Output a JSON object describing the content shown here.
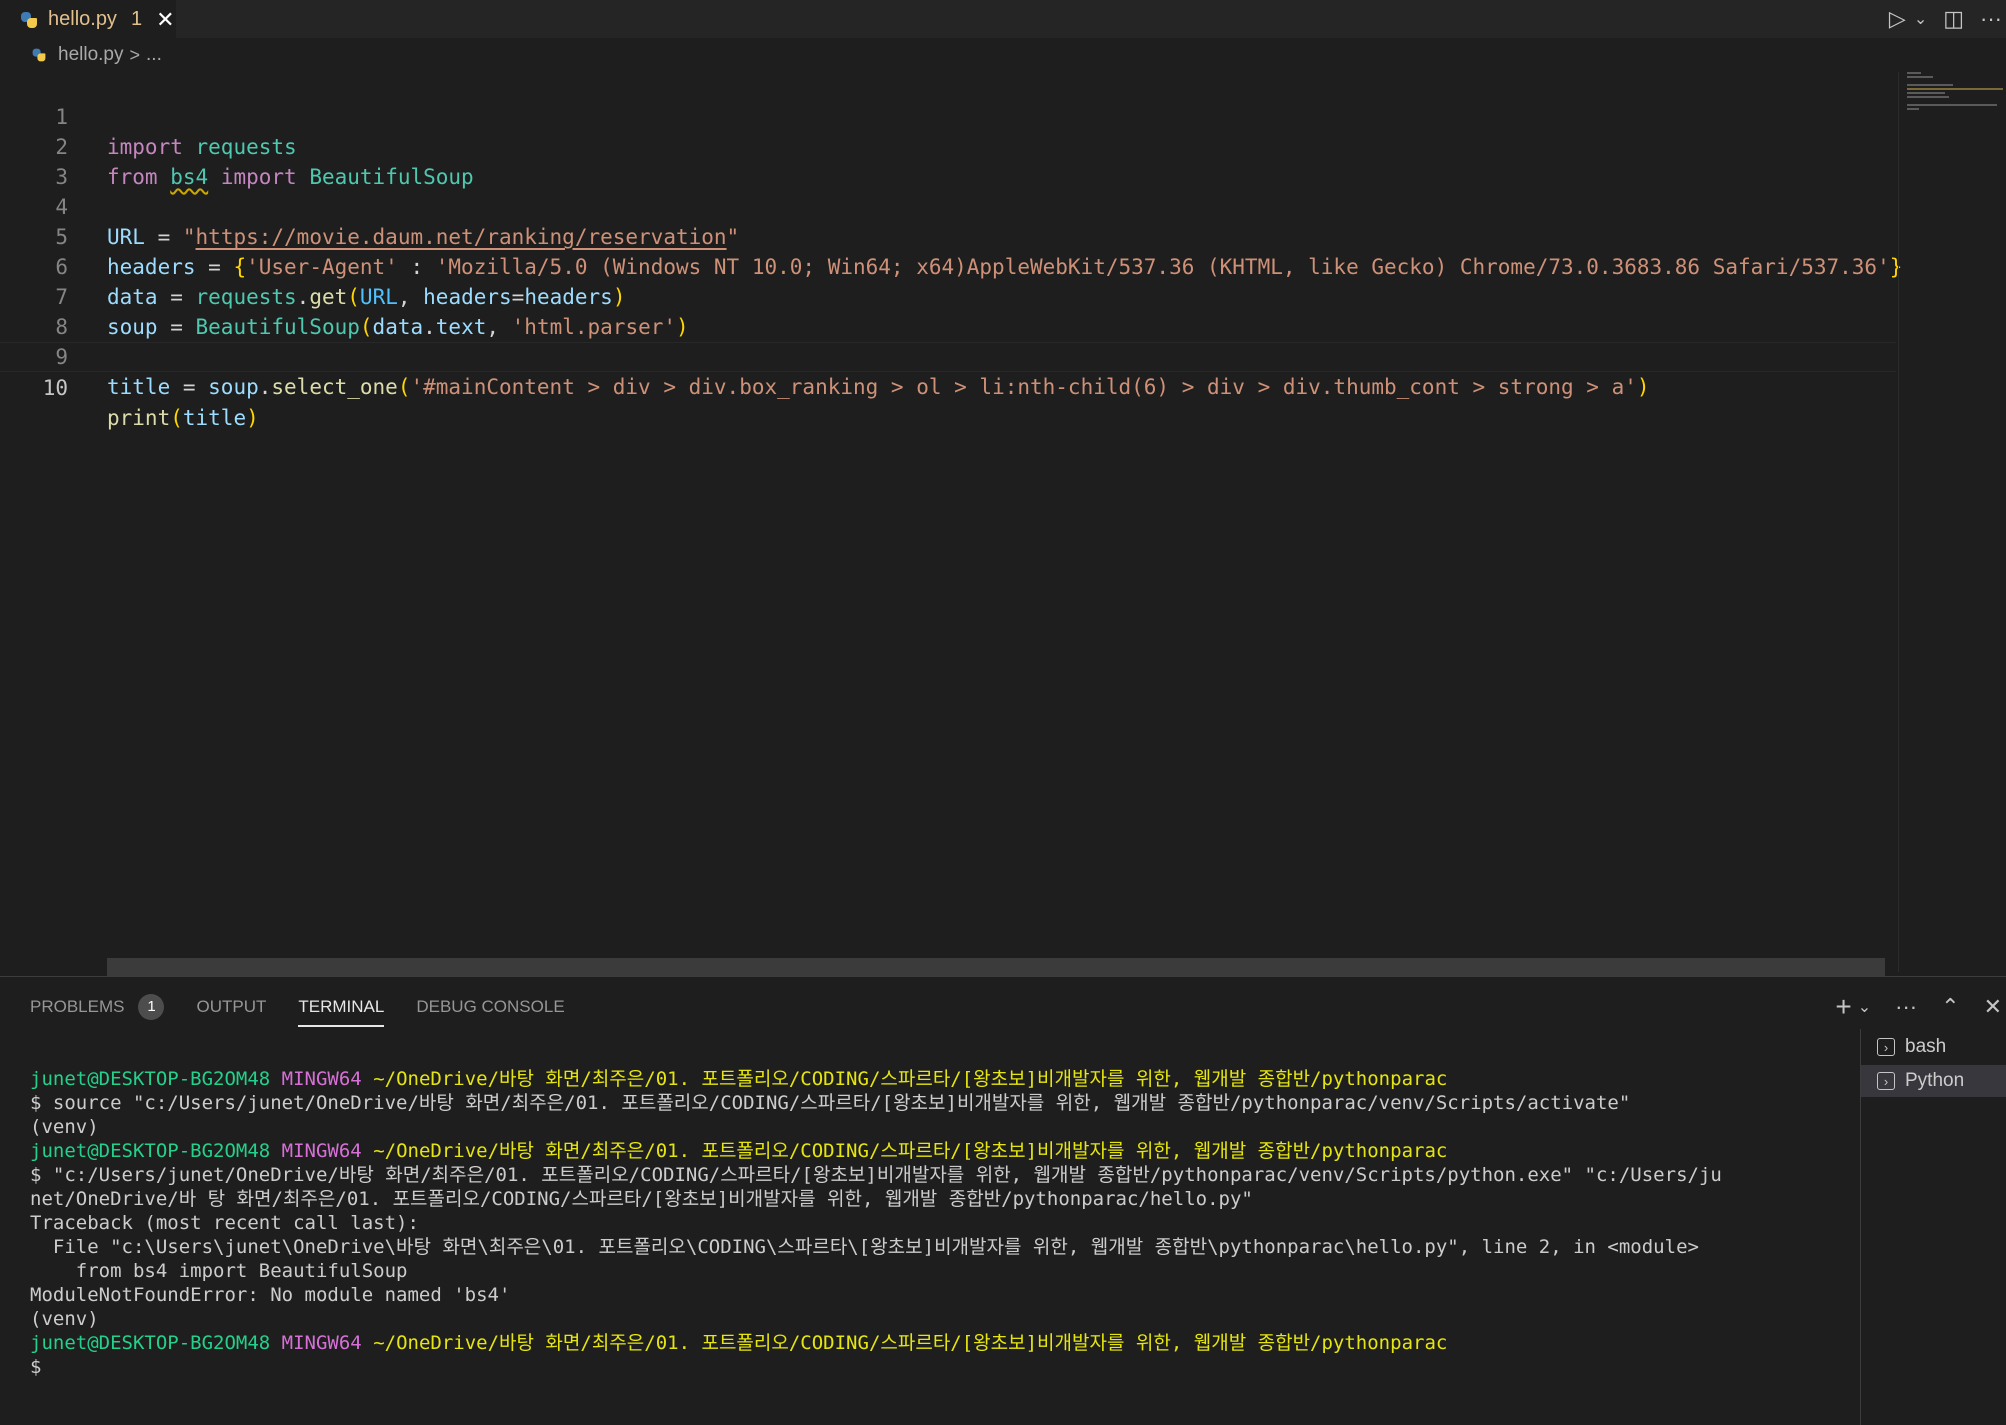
{
  "tab": {
    "filename": "hello.py",
    "problem_count": "1",
    "close_glyph": "✕"
  },
  "actions": {
    "run": "▷",
    "run_dropdown": "⌄",
    "split": "◫",
    "more": "···"
  },
  "breadcrumb": {
    "file": "hello.py",
    "separator": ">",
    "more": "..."
  },
  "editor": {
    "line_numbers": [
      "1",
      "2",
      "3",
      "4",
      "5",
      "6",
      "7",
      "8",
      "9",
      "10"
    ],
    "lines": [
      "import requests",
      "from bs4 import BeautifulSoup",
      "",
      "URL = \"https://movie.daum.net/ranking/reservation\"",
      "headers = {'User-Agent' : 'Mozilla/5.0 (Windows NT 10.0; Win64; x64)AppleWebKit/537.36 (KHTML, like Gecko) Chrome/73.0.3683.86 Safari/537.36'}",
      "data = requests.get(URL, headers=headers)",
      "soup = BeautifulSoup(data.text, 'html.parser')",
      "",
      "title = soup.select_one('#mainContent > div > div.box_ranking > ol > li:nth-child(6) > div > div.thumb_cont > strong > a')",
      "print(title)"
    ],
    "tokens": {
      "l1": [
        "import",
        " ",
        "requests"
      ],
      "l2": [
        "from",
        " ",
        "bs4",
        " ",
        "import",
        " ",
        "BeautifulSoup"
      ],
      "l4": [
        "URL",
        " = ",
        "\"",
        "https://movie.daum.net/ranking/reservation",
        "\""
      ],
      "l5": [
        "headers",
        " = ",
        "{",
        "'User-Agent'",
        " : ",
        "'Mozilla/5.0 (Windows NT 10.0; Win64; x64)AppleWebKit/537.36 (KHTML, like Gecko) Chrome/73.0.3683.86 Safari/537.36'",
        "}"
      ],
      "l6": [
        "data",
        " = ",
        "requests",
        ".",
        "get",
        "(",
        "URL",
        ", ",
        "headers",
        "=",
        "headers",
        ")"
      ],
      "l7": [
        "soup",
        " = ",
        "BeautifulSoup",
        "(",
        "data",
        ".",
        "text",
        ", ",
        "'html.parser'",
        ")"
      ],
      "l9": [
        "title",
        " = ",
        "soup",
        ".",
        "select_one",
        "(",
        "'#mainContent > div > div.box_ranking > ol > li:nth-child(6) > div > div.thumb_cont > strong > a'",
        ")"
      ],
      "l10": [
        "print",
        "(",
        "title",
        ")"
      ]
    }
  },
  "panel": {
    "tabs": [
      "PROBLEMS",
      "OUTPUT",
      "TERMINAL",
      "DEBUG CONSOLE"
    ],
    "problems_badge": "1",
    "actions": {
      "new_terminal": "+",
      "dropdown": "⌄",
      "more": "···",
      "maximize": "⌃",
      "close": "✕"
    },
    "terminal_sessions": [
      "bash",
      "Python"
    ]
  },
  "terminal": {
    "prompt_user": "junet@DESKTOP-BG2OM48",
    "prompt_system": "MINGW64",
    "prompt_path": "~/OneDrive/바탕 화면/최주은/01. 포트폴리오/CODING/스파르타/[왕초보]비개발자를 위한, 웹개발 종합반/pythonparac",
    "lines": [
      "$ source \"c:/Users/junet/OneDrive/바탕 화면/최주은/01. 포트폴리오/CODING/스파르타/[왕초보]비개발자를 위한, 웹개발 종합반/pythonparac/venv/Scripts/activate\"",
      "(venv)",
      "$ \"c:/Users/junet/OneDrive/바탕 화면/최주은/01. 포트폴리오/CODING/스파르타/[왕초보]비개발자를 위한, 웹개발 종합반/pythonparac/venv/Scripts/python.exe\" \"c:/Users/ju",
      "net/OneDrive/바 탕 화면/최주은/01. 포트폴리오/CODING/스파르타/[왕초보]비개발자를 위한, 웹개발 종합반/pythonparac/hello.py\"",
      "Traceback (most recent call last):",
      "  File \"c:\\Users\\junet\\OneDrive\\바탕 화면\\최주은\\01. 포트폴리오\\CODING\\스파르타\\[왕초보]비개발자를 위한, 웹개발 종합반\\pythonparac\\hello.py\", line 2, in <module>",
      "    from bs4 import BeautifulSoup",
      "ModuleNotFoundError: No module named 'bs4'",
      "(venv)",
      "$"
    ]
  }
}
